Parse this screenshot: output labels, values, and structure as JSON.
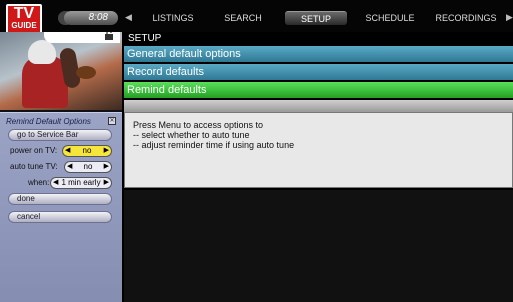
{
  "logo": {
    "line1": "TV",
    "line2": "GUIDE"
  },
  "clock": "8:08",
  "nav": {
    "left_arrow": "◀",
    "right_arrow": "▶",
    "tabs": [
      {
        "label": "LISTINGS",
        "active": false
      },
      {
        "label": "SEARCH",
        "active": false
      },
      {
        "label": "SETUP",
        "active": true
      },
      {
        "label": "SCHEDULE",
        "active": false
      },
      {
        "label": "RECORDINGS",
        "active": false
      }
    ]
  },
  "video": {
    "lock_icon": "lock-icon"
  },
  "panel": {
    "title": "Remind Default Options",
    "close_glyph": "✕",
    "service_bar": "go to Service Bar",
    "power_on_tv": {
      "label": "power on TV:",
      "value": "no"
    },
    "auto_tune_tv": {
      "label": "auto tune TV:",
      "value": "no"
    },
    "when": {
      "label": "when:",
      "value": "1 min early"
    },
    "done": "done",
    "cancel": "cancel"
  },
  "setup": {
    "header": "SETUP",
    "items": [
      {
        "label": "General default options",
        "state": "normal"
      },
      {
        "label": "Record defaults",
        "state": "normal"
      },
      {
        "label": "Remind defaults",
        "state": "selected"
      }
    ]
  },
  "help": {
    "line1": "Press Menu to access options to",
    "line2": "-- select whether to auto tune",
    "line3": "-- adjust reminder time if using auto tune"
  },
  "colors": {
    "logo_red": "#d01818",
    "teal": "#3a86a2",
    "green": "#2eb82e",
    "panel": "#949bbf",
    "highlight_yellow": "#f6e63c"
  }
}
